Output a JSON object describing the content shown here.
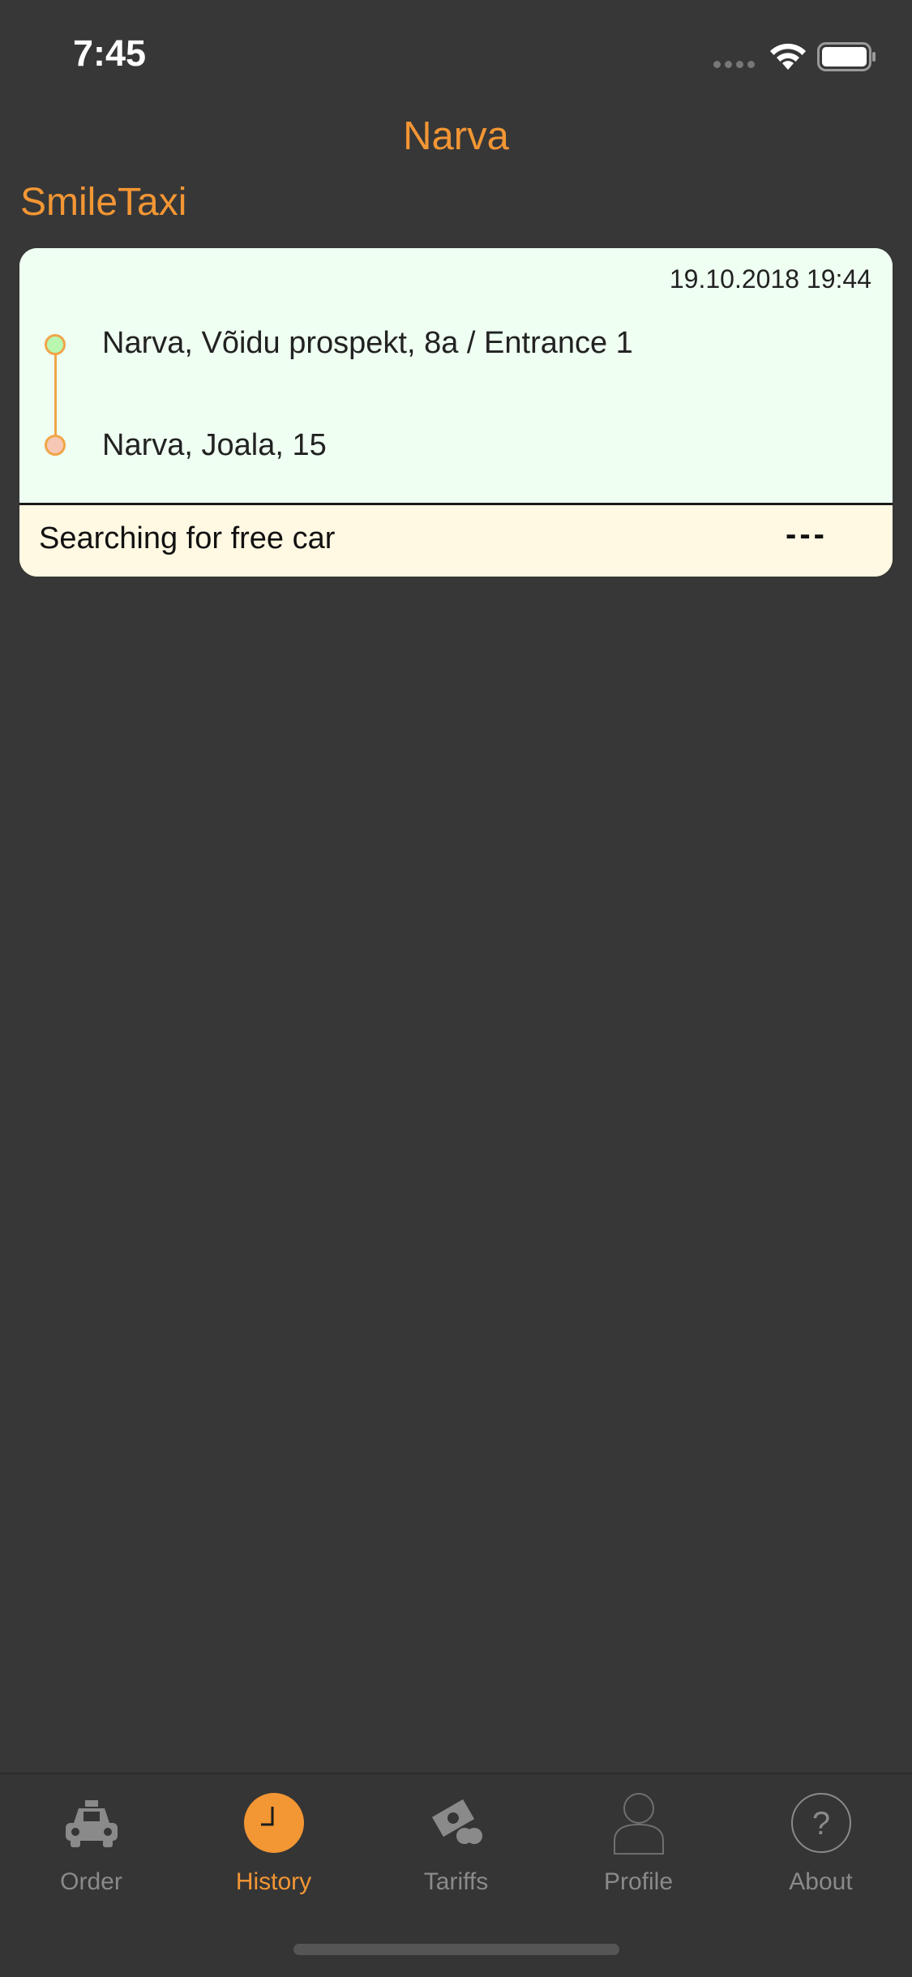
{
  "status_bar": {
    "time": "7:45"
  },
  "header": {
    "title": "Narva",
    "brand": "SmileTaxi"
  },
  "order": {
    "date": "19.10.2018 19:44",
    "from": "Narva, Võidu prospekt, 8a / Entrance 1",
    "to": "Narva, Joala, 15",
    "status": "Searching for free car",
    "price": "---"
  },
  "tabs": [
    {
      "label": "Order",
      "icon": "taxi-icon",
      "active": false
    },
    {
      "label": "History",
      "icon": "clock-icon",
      "active": true
    },
    {
      "label": "Tariffs",
      "icon": "money-icon",
      "active": false
    },
    {
      "label": "Profile",
      "icon": "person-icon",
      "active": false
    },
    {
      "label": "About",
      "icon": "question-icon",
      "active": false
    }
  ],
  "colors": {
    "accent": "#f39634",
    "background": "#373737",
    "card_route_bg": "#effff2",
    "card_status_bg": "#fff9e3",
    "tab_inactive": "#8a8a8a"
  }
}
